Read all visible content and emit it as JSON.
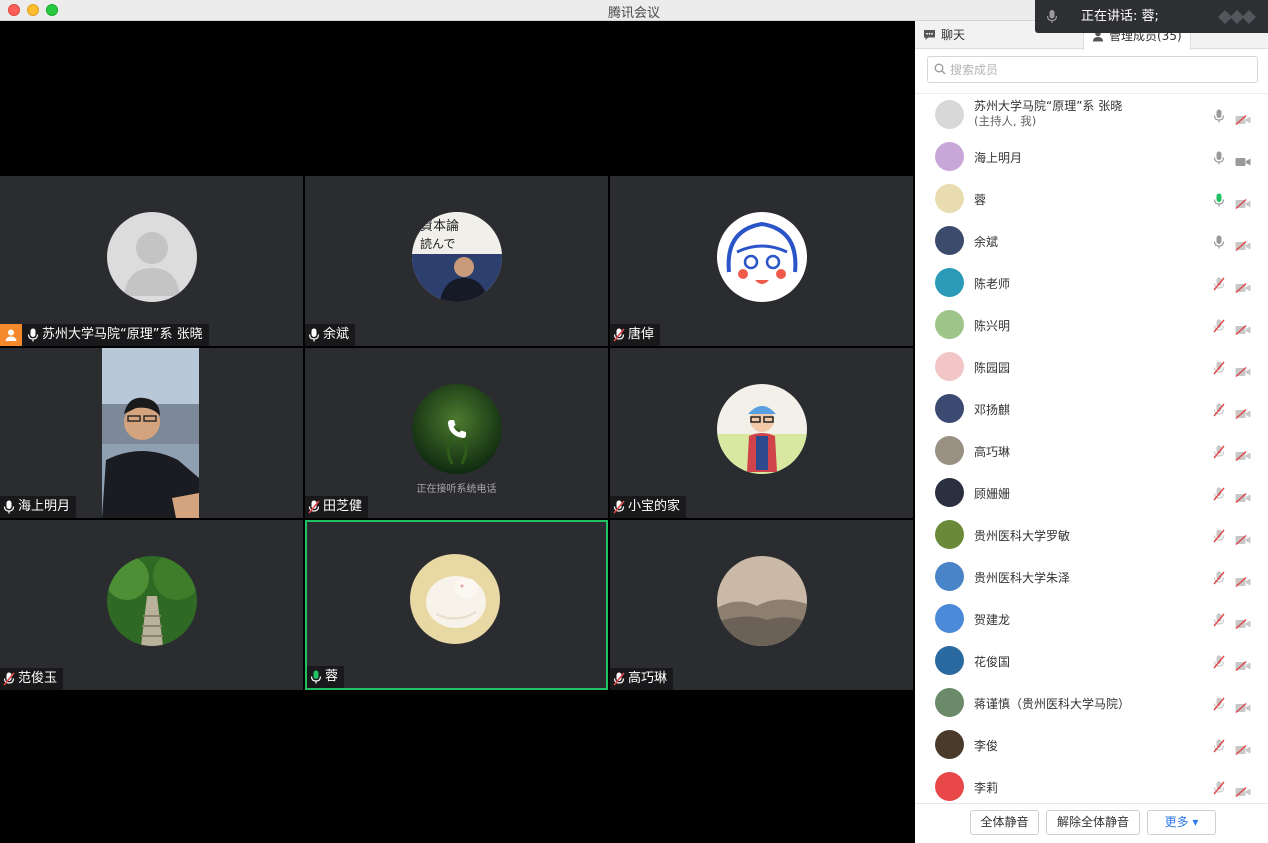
{
  "window": {
    "title": "腾讯会议"
  },
  "speaking": {
    "text": "正在讲话: 蓉;"
  },
  "tiles": [
    {
      "name": "苏州大学马院“原理”系 张晓",
      "host": true,
      "mic": "on"
    },
    {
      "name": "余斌",
      "mic": "on"
    },
    {
      "name": "唐倬",
      "mic": "muted"
    },
    {
      "name": "海上明月",
      "mic": "on"
    },
    {
      "name": "田芝健",
      "mic": "muted",
      "caption": "正在接听系统电话"
    },
    {
      "name": "小宝的家",
      "mic": "muted"
    },
    {
      "name": "范俊玉",
      "mic": "muted"
    },
    {
      "name": "蓉",
      "mic": "speaking"
    },
    {
      "name": "高巧琳",
      "mic": "muted"
    }
  ],
  "panel": {
    "tab_chat": "聊天",
    "tab_members": "管理成员(35)",
    "search_placeholder": "搜索成员",
    "members": [
      {
        "name": "苏州大学马院“原理”系 张晓",
        "sub": "(主持人, 我)"
      },
      {
        "name": "海上明月"
      },
      {
        "name": "蓉"
      },
      {
        "name": "余斌"
      },
      {
        "name": "陈老师"
      },
      {
        "name": "陈兴明"
      },
      {
        "name": "陈园园"
      },
      {
        "name": "邓扬麒"
      },
      {
        "name": "高巧琳"
      },
      {
        "name": "顾姗姗"
      },
      {
        "name": "贵州医科大学罗敏"
      },
      {
        "name": "贵州医科大学朱泽"
      },
      {
        "name": "贺建龙"
      },
      {
        "name": "花俊国"
      },
      {
        "name": "蒋谨慎（贵州医科大学马院）"
      },
      {
        "name": "李俊"
      },
      {
        "name": "李莉"
      }
    ],
    "buttons": {
      "mute_all": "全体静音",
      "unmute_all": "解除全体静音",
      "more": "更多 ▾"
    }
  },
  "colors": {
    "accent": "#20c063",
    "host": "#f5892c",
    "muted": "#e04848",
    "link": "#2f7ae5"
  }
}
